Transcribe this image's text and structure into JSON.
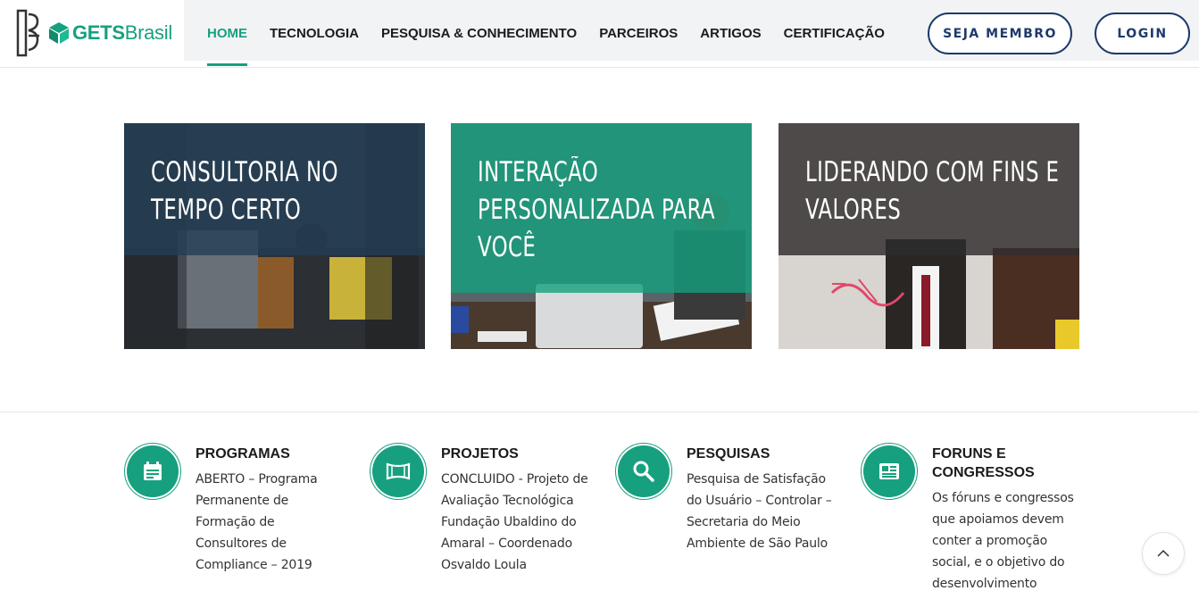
{
  "brand": {
    "logo_text_bold": "GETS",
    "logo_text_light": "Brasil",
    "accent_color": "#17a07f",
    "navy_color": "#1d3a6b"
  },
  "nav": {
    "items": [
      {
        "label": "HOME",
        "active": true
      },
      {
        "label": "TECNOLOGIA",
        "active": false
      },
      {
        "label": "PESQUISA & CONHECIMENTO",
        "active": false
      },
      {
        "label": "PARCEIROS",
        "active": false
      },
      {
        "label": "ARTIGOS",
        "active": false
      },
      {
        "label": "CERTIFICAÇÃO",
        "active": false
      }
    ],
    "member_button": "SEJA MEMBRO",
    "login_button": "LOGIN"
  },
  "cards": [
    {
      "title": "CONSULTORIA NO TEMPO CERTO"
    },
    {
      "title": "INTERAÇÃO PERSONALIZADA PARA VOCÊ"
    },
    {
      "title": "LIDERANDO COM FINS E VALORES"
    }
  ],
  "features": [
    {
      "icon": "calendar-icon",
      "title": "PROGRAMAS",
      "text": "ABERTO – Programa Permanente de Formação de Consultores de Compliance – 2019"
    },
    {
      "icon": "map-icon",
      "title": "PROJETOS",
      "text": "CONCLUIDO - Projeto de Avaliação Tecnológica Fundação Ubaldino do Amaral – Coordenado Osvaldo Loula"
    },
    {
      "icon": "search-icon",
      "title": "PESQUISAS",
      "text": "Pesquisa de Satisfação do Usuário – Controlar – Secretaria do Meio Ambiente de São Paulo"
    },
    {
      "icon": "newspaper-icon",
      "title": "FORUNS E CONGRESSOS",
      "text": "Os fóruns e congressos que apoiamos devem conter a promoção social, e o objetivo do desenvolvimento"
    }
  ],
  "scroll_top_icon": "chevron-up-icon"
}
